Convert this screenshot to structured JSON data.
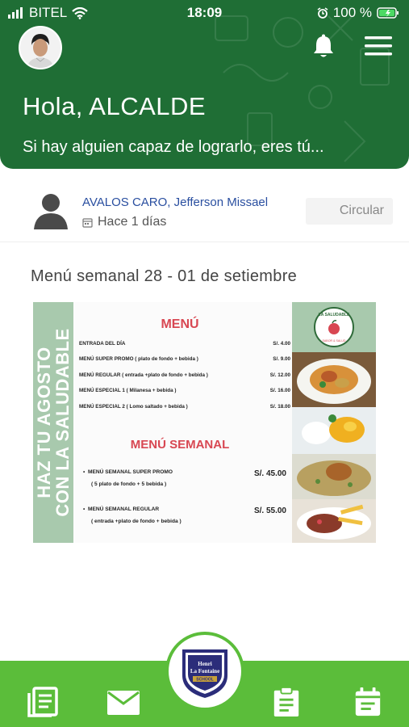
{
  "status_bar": {
    "carrier": "BITEL",
    "time": "18:09",
    "battery": "100 %"
  },
  "header": {
    "greeting": "Hola, ALCALDE",
    "subtitle": "Si hay alguien capaz de lograrlo, eres tú..."
  },
  "post": {
    "author": "AVALOS CARO, Jefferson Missael",
    "time_ago": "Hace 1 días",
    "category_button": "Circular",
    "title": "Menú semanal 28 - 01 de setiembre"
  },
  "flyer": {
    "side_text_line1": "HAZ TU AGOSTO",
    "side_text_line2": "CON LA SALUDABLE",
    "menu_title": "MENÚ",
    "items": [
      {
        "name": "ENTRADA DEL DÍA",
        "price": "S/. 4.00"
      },
      {
        "name": "MENÚ SUPER PROMO ( plato de fondo + bebida )",
        "price": "S/. 9.00"
      },
      {
        "name": "MENÚ REGULAR ( entrada +plato de fondo + bebida )",
        "price": "S/. 12.00"
      },
      {
        "name": "MENÚ ESPECIAL 1 ( Milanesa + bebida )",
        "price": "S/. 16.00"
      },
      {
        "name": "MENÚ ESPECIAL 2 ( Lomo saltado + bebida )",
        "price": "S/. 18.00"
      }
    ],
    "weekly_title": "MENÚ SEMANAL",
    "weekly_items": [
      {
        "name": "MENÚ SEMANAL SUPER PROMO",
        "detail": "( 5 plato de fondo + 5 bebida )",
        "price": "S/. 45.00"
      },
      {
        "name": "MENÚ SEMANAL REGULAR",
        "detail": "( entrada +plato de fondo + bebida )",
        "price": "S/. 55.00"
      }
    ],
    "brand": "LA SALUDABLE",
    "brand_sub": "SABOR & SALUD"
  },
  "school_logo": {
    "line1": "Henri",
    "line2": "La Fontaine",
    "line3": "SCHOOL"
  },
  "colors": {
    "header_green": "#1f6e35",
    "nav_green": "#5bbd3a",
    "link_blue": "#2a4fa0",
    "flyer_red": "#d84752"
  },
  "icons": [
    "wifi-icon",
    "alarm-icon",
    "battery-icon",
    "bell-icon",
    "hamburger-menu-icon",
    "user-silhouette-icon",
    "calendar-small-icon",
    "news-icon",
    "mail-icon",
    "clipboard-icon",
    "calendar-icon"
  ]
}
